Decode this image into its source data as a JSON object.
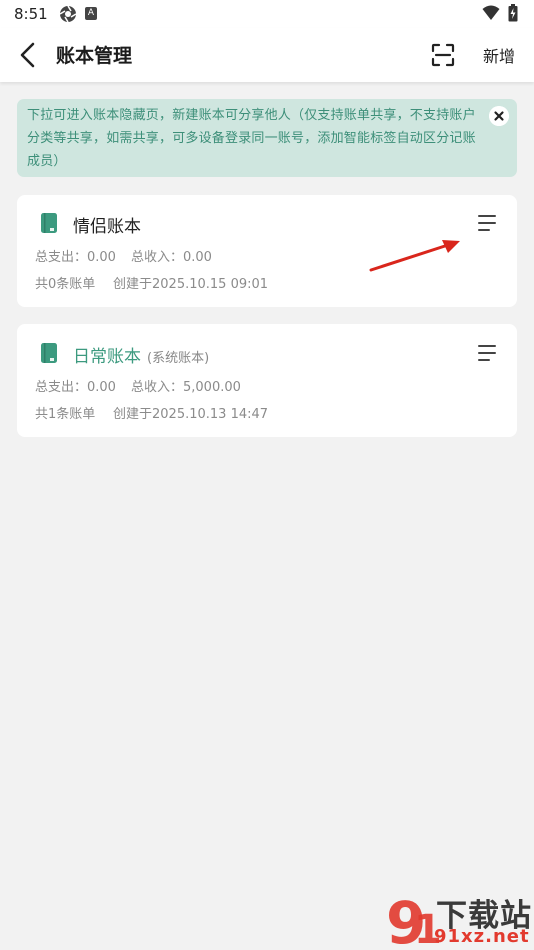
{
  "status": {
    "time": "8:51",
    "badge": "A"
  },
  "header": {
    "title": "账本管理",
    "add_label": "新增"
  },
  "notice": {
    "text": "下拉可进入账本隐藏页，新建账本可分享他人（仅支持账单共享，不支持账户分类等共享，如需共享，可多设备登录同一账号，添加智能标签自动区分记账成员）"
  },
  "books": [
    {
      "name": "情侣账本",
      "tag": "",
      "expense": "总支出：0.00",
      "income": "总收入：0.00",
      "count": "共0条账单",
      "created": "创建于2025.10.15 09:01"
    },
    {
      "name": "日常账本",
      "tag": "(系统账本)",
      "expense": "总支出：0.00",
      "income": "总收入：5,000.00",
      "count": "共1条账单",
      "created": "创建于2025.10.13 14:47"
    }
  ],
  "watermark": {
    "cn": "下载站",
    "en": "91xz.net"
  },
  "colors": {
    "accent": "#3c9a7f",
    "notice_bg": "#cfe6df",
    "notice_text": "#3d8f79",
    "arrow": "#d9261c"
  }
}
